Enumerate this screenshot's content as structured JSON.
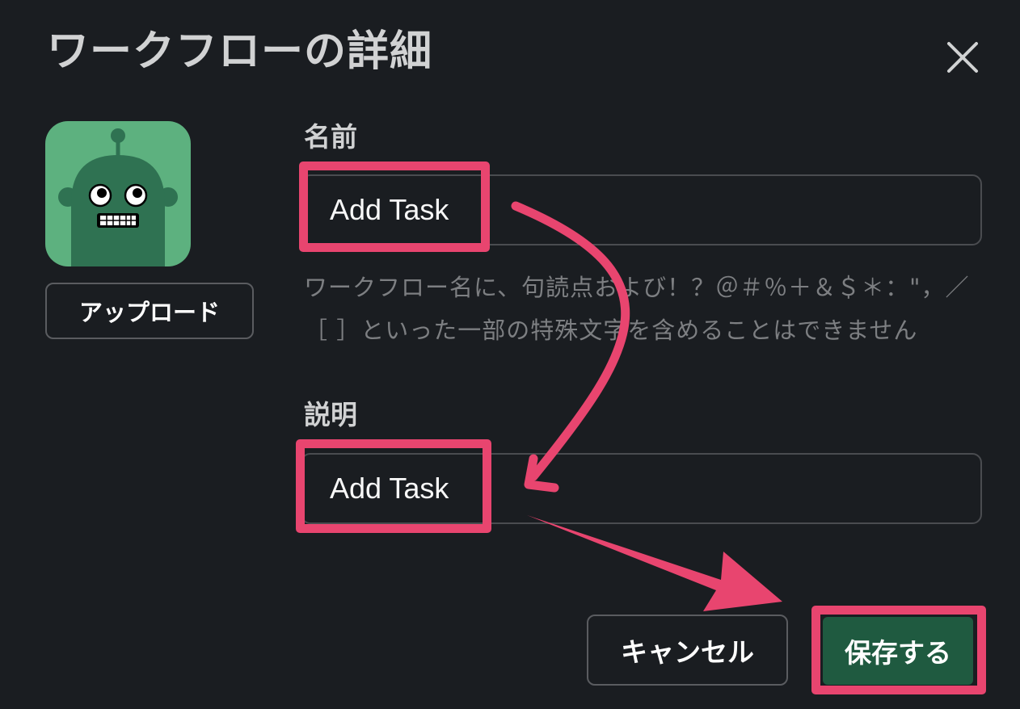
{
  "dialog": {
    "title": "ワークフローの詳細"
  },
  "icons": {
    "close": "close-icon",
    "avatar": "robot-avatar-icon"
  },
  "avatar": {
    "upload_label": "アップロード"
  },
  "name_field": {
    "label": "名前",
    "value": "Add Task",
    "help_text": "ワークフロー名に、句読点および！？＠＃％＋＆＄＊：\"，／［ ］といった一部の特殊文字を含めることはできません"
  },
  "description_field": {
    "label": "説明",
    "value": "Add Task"
  },
  "footer": {
    "cancel_label": "キャンセル",
    "save_label": "保存する"
  },
  "colors": {
    "background": "#1a1d21",
    "avatar_green": "#5db17f",
    "save_button": "#1f5a40",
    "annotation": "#e8456f"
  }
}
